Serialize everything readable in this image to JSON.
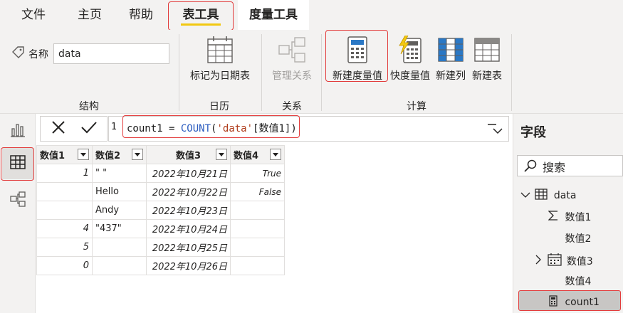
{
  "menu": {
    "tabs": [
      {
        "label": "文件"
      },
      {
        "label": "主页"
      },
      {
        "label": "帮助"
      },
      {
        "label": "表工具"
      },
      {
        "label": "度量工具"
      }
    ],
    "active_tab": "表工具"
  },
  "ribbon": {
    "structure": {
      "group_label": "结构",
      "name_label": "名称",
      "name_value": "data"
    },
    "calendar": {
      "group_label": "日历",
      "mark_as_date_table": "标记为日期表"
    },
    "relations": {
      "group_label": "关系",
      "manage_relations": "管理关系"
    },
    "calculations": {
      "group_label": "计算",
      "new_measure": "新建度量值",
      "quick_measure": "快度量值",
      "new_column": "新建列",
      "new_table": "新建表"
    }
  },
  "formula_bar": {
    "line_number": "1",
    "formula_name": "count1",
    "formula_eq": " = ",
    "formula_fn": "COUNT",
    "formula_open": "(",
    "formula_table": "'data'",
    "formula_column": "[数值1]",
    "formula_close": ")"
  },
  "table": {
    "columns": [
      "数值1",
      "数值2",
      "数值3",
      "数值4"
    ],
    "rows": [
      [
        "1",
        "\" \"",
        "2022年10月21日",
        "True"
      ],
      [
        "",
        "Hello",
        "2022年10月22日",
        "False"
      ],
      [
        "",
        "Andy",
        "2022年10月23日",
        ""
      ],
      [
        "4",
        "\"437\"",
        "2022年10月24日",
        ""
      ],
      [
        "5",
        "",
        "2022年10月25日",
        ""
      ],
      [
        "0",
        "",
        "2022年10月26日",
        ""
      ]
    ]
  },
  "fields": {
    "title": "字段",
    "search_placeholder": "搜索",
    "table_name": "data",
    "items": [
      {
        "label": "数值1",
        "icon": "sigma-icon"
      },
      {
        "label": "数值2",
        "icon": ""
      },
      {
        "label": "数值3",
        "icon": "calendar-icon"
      },
      {
        "label": "数值4",
        "icon": ""
      },
      {
        "label": "count1",
        "icon": "calculator-icon"
      }
    ]
  },
  "colors": {
    "accent_yellow": "#f2c811",
    "highlight_red": "#e23c3c",
    "ribbon_bg": "#f3f2f1",
    "selected_field_bg": "#c8c6c4"
  }
}
